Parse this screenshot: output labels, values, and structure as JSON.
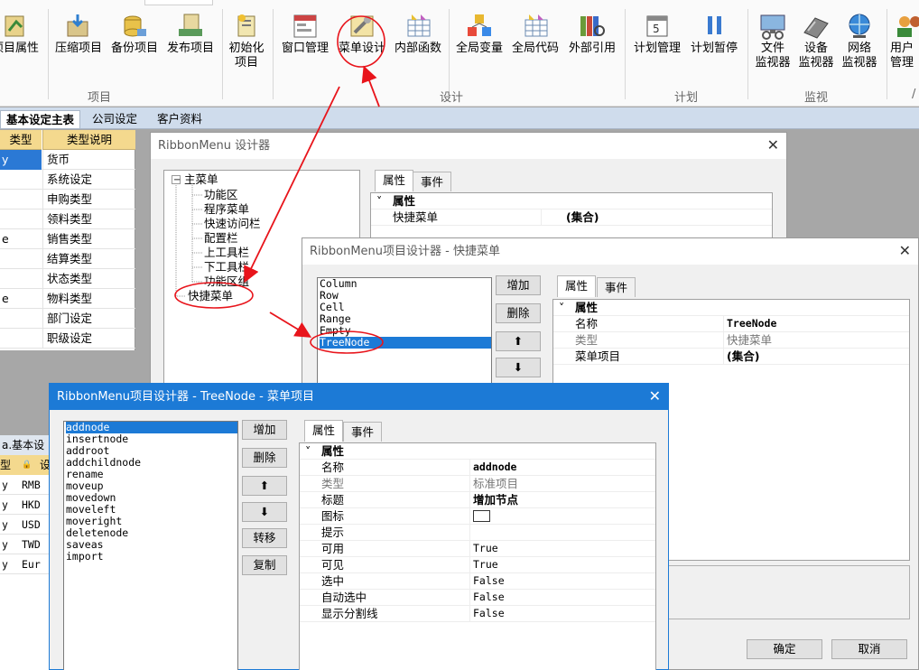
{
  "ribbon": {
    "buttons": [
      {
        "label": "项目属性",
        "icon": "project-properties-icon"
      },
      {
        "label": "压缩项目",
        "icon": "compress-icon"
      },
      {
        "label": "备份项目",
        "icon": "backup-icon"
      },
      {
        "label": "发布项目",
        "icon": "publish-icon"
      },
      {
        "label": "初始化",
        "label2": "项目",
        "icon": "initialize-icon"
      },
      {
        "label": "窗口管理",
        "icon": "window-manage-icon"
      },
      {
        "label": "菜单设计",
        "icon": "menu-design-icon"
      },
      {
        "label": "内部函数",
        "icon": "internal-function-icon"
      },
      {
        "label": "全局变量",
        "icon": "global-variable-icon"
      },
      {
        "label": "全局代码",
        "icon": "global-code-icon"
      },
      {
        "label": "外部引用",
        "icon": "external-reference-icon"
      },
      {
        "label": "计划管理",
        "icon": "schedule-manage-icon"
      },
      {
        "label": "计划暂停",
        "icon": "pause-icon"
      },
      {
        "label": "文件",
        "label2": "监视器",
        "icon": "file-monitor-icon"
      },
      {
        "label": "设备",
        "label2": "监视器",
        "icon": "device-monitor-icon"
      },
      {
        "label": "网络",
        "label2": "监视器",
        "icon": "network-monitor-icon"
      },
      {
        "label": "用户",
        "label2": "管理",
        "icon": "user-manage-icon"
      }
    ],
    "groups": [
      "项目",
      "设计",
      "计划",
      "监视"
    ]
  },
  "main_tabs": [
    "基本设定主表",
    "公司设定",
    "客户资料"
  ],
  "left_grid": {
    "headers": [
      "类型",
      "类型说明"
    ],
    "rows": [
      [
        "y",
        "货币"
      ],
      [
        "",
        "系统设定"
      ],
      [
        "",
        "申购类型"
      ],
      [
        "",
        "领料类型"
      ],
      [
        "e",
        "销售类型"
      ],
      [
        "",
        "结算类型"
      ],
      [
        "",
        "状态类型"
      ],
      [
        "e",
        "物料类型"
      ],
      [
        "",
        "部门设定"
      ],
      [
        "",
        "职级设定"
      ]
    ]
  },
  "left_grid2": {
    "header": "基本设",
    "sub_header": [
      "型",
      "设"
    ],
    "rows": [
      [
        "y",
        "RMB"
      ],
      [
        "y",
        "HKD"
      ],
      [
        "y",
        "USD"
      ],
      [
        "y",
        "TWD"
      ],
      [
        "y",
        "Eur"
      ]
    ]
  },
  "dialog1": {
    "title": "RibbonMenu 设计器",
    "close": "✕",
    "tree_root": "主菜单",
    "tree_children": [
      "功能区",
      "程序菜单",
      "快速访问栏",
      "配置栏",
      "上工具栏",
      "下工具栏",
      "功能区组"
    ],
    "tree_other": "快捷菜单",
    "tabs": [
      "属性",
      "事件"
    ],
    "prop_header": "属性",
    "props": [
      {
        "k": "快捷菜单",
        "v": "(集合)"
      }
    ]
  },
  "dialog2": {
    "title": "RibbonMenu项目设计器 - 快捷菜单",
    "close": "✕",
    "list": [
      "Column",
      "Row",
      "Cell",
      "Range",
      "Empty",
      "TreeNode"
    ],
    "selected": "TreeNode",
    "buttons": [
      "增加",
      "删除",
      "⬆",
      "⬇"
    ],
    "tabs": [
      "属性",
      "事件"
    ],
    "prop_header": "属性",
    "props": [
      {
        "k": "名称",
        "v": "TreeNode"
      },
      {
        "k": "类型",
        "v": "快捷菜单"
      },
      {
        "k": "菜单项目",
        "v": "(集合)"
      }
    ],
    "ok": "确定",
    "cancel": "取消"
  },
  "dialog3": {
    "title": "RibbonMenu项目设计器 - TreeNode - 菜单项目",
    "close": "✕",
    "list": [
      "addnode",
      "insertnode",
      "addroot",
      "addchildnode",
      "rename",
      "moveup",
      "movedown",
      "moveleft",
      "moveright",
      "deletenode",
      "saveas",
      "import"
    ],
    "selected": "addnode",
    "buttons": [
      "增加",
      "删除",
      "⬆",
      "⬇",
      "转移",
      "复制"
    ],
    "tabs": [
      "属性",
      "事件"
    ],
    "prop_header": "属性",
    "props": [
      {
        "k": "名称",
        "v": "addnode"
      },
      {
        "k": "类型",
        "v": "标准项目"
      },
      {
        "k": "标题",
        "v": "增加节点"
      },
      {
        "k": "图标",
        "v": ""
      },
      {
        "k": "提示",
        "v": ""
      },
      {
        "k": "可用",
        "v": "True"
      },
      {
        "k": "可见",
        "v": "True"
      },
      {
        "k": "选中",
        "v": "False"
      },
      {
        "k": "自动选中",
        "v": "False"
      },
      {
        "k": "显示分割线",
        "v": "False"
      }
    ]
  },
  "colors": {
    "accent": "#1c7ad6",
    "annotation": "#e8141b",
    "grid_header": "#f4d98e"
  }
}
